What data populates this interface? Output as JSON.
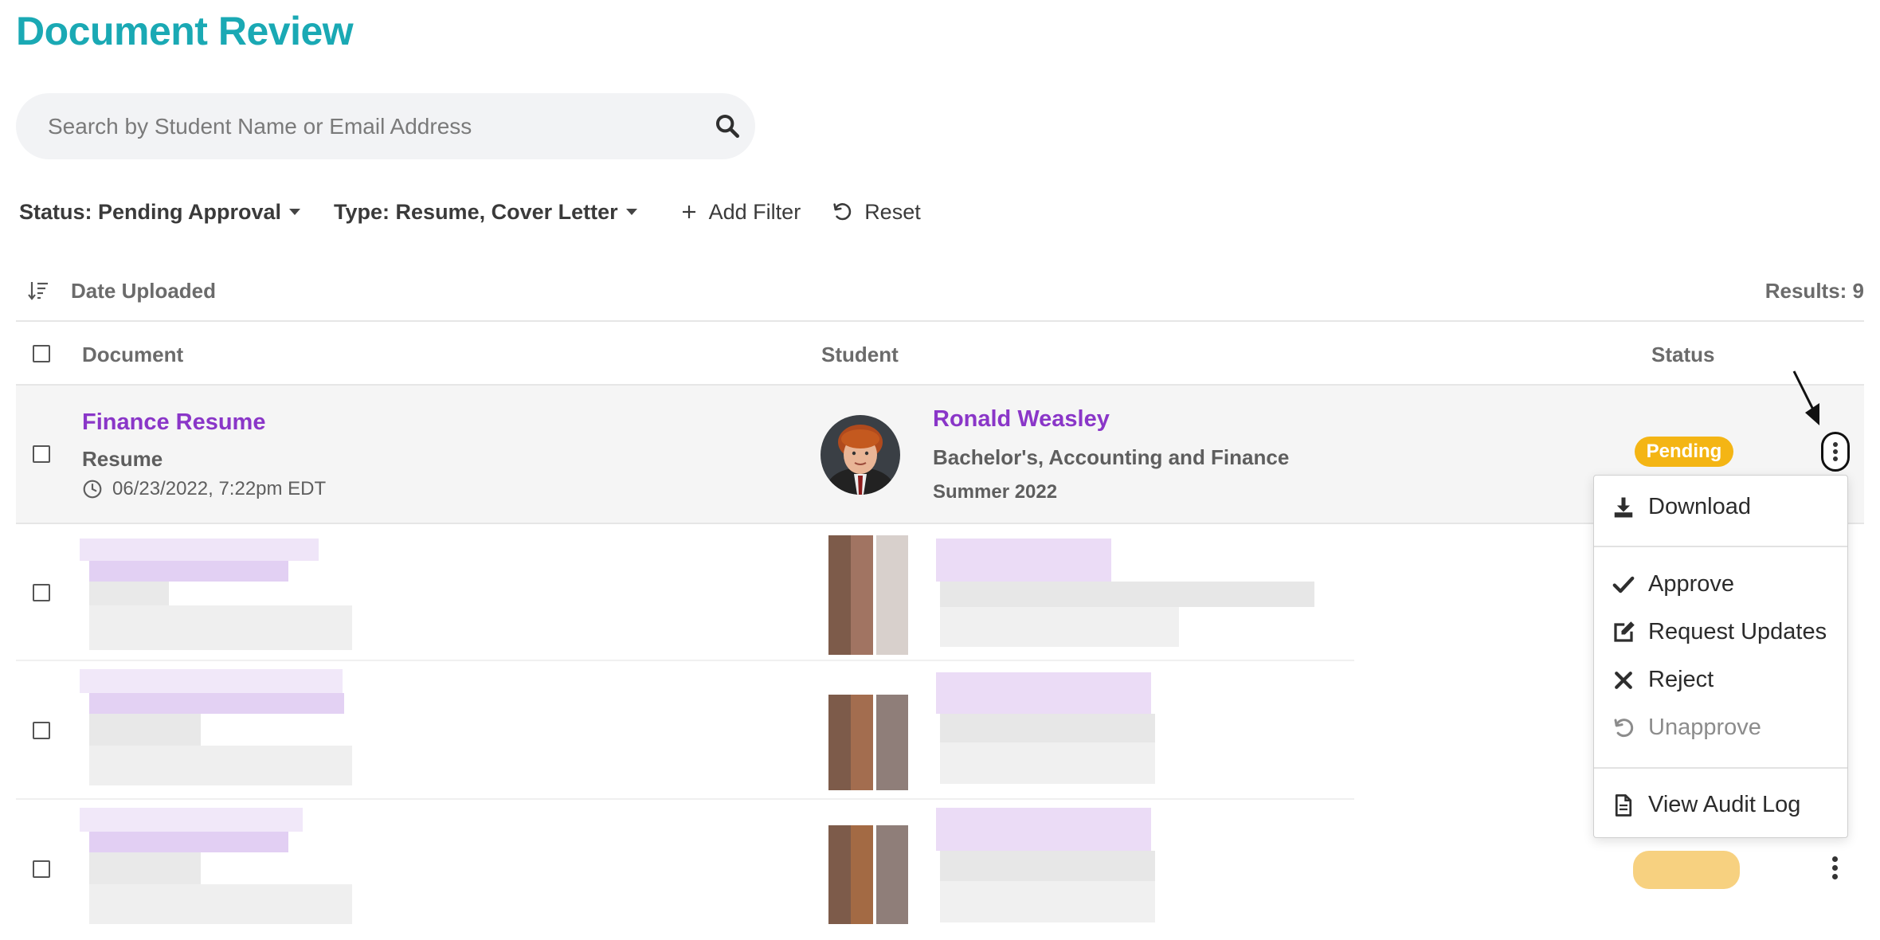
{
  "page": {
    "title": "Document Review"
  },
  "search": {
    "placeholder": "Search by Student Name or Email Address"
  },
  "filters": {
    "status_label": "Status: Pending Approval",
    "type_label": "Type: Resume, Cover Letter",
    "add_filter_label": "Add Filter",
    "reset_label": "Reset"
  },
  "sort": {
    "label": "Date Uploaded"
  },
  "results": {
    "label": "Results: 9"
  },
  "table": {
    "columns": {
      "document": "Document",
      "student": "Student",
      "status": "Status"
    },
    "rows": [
      {
        "document_title": "Finance Resume",
        "document_type": "Resume",
        "uploaded": "06/23/2022, 7:22pm EDT",
        "student_name": "Ronald Weasley",
        "student_degree": "Bachelor's, Accounting and Finance",
        "student_term": "Summer 2022",
        "status": "Pending"
      }
    ]
  },
  "menu": {
    "items": [
      {
        "label": "Download",
        "icon": "download-icon"
      },
      {
        "label": "Approve",
        "icon": "check-icon"
      },
      {
        "label": "Request Updates",
        "icon": "edit-icon"
      },
      {
        "label": "Reject",
        "icon": "x-icon"
      },
      {
        "label": "Unapprove",
        "icon": "undo-icon",
        "disabled": true
      },
      {
        "label": "View Audit Log",
        "icon": "document-icon"
      }
    ]
  },
  "colors": {
    "title": "#1aa9b4",
    "link": "#8a36c8",
    "pending": "#f4b514"
  }
}
